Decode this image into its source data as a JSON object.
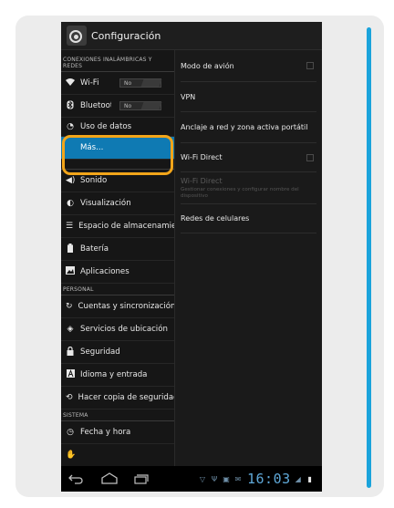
{
  "header": {
    "title": "Configuración"
  },
  "sections": {
    "wireless": "CONEXIONES INALÁMBRICAS Y REDES",
    "personal": "PERSONAL",
    "system": "SISTEMA"
  },
  "wireless_items": [
    {
      "label": "Wi-Fi",
      "toggle": "No"
    },
    {
      "label": "Bluetooth",
      "toggle": "No"
    },
    {
      "label": "Uso de datos"
    },
    {
      "label": "Más..."
    }
  ],
  "device_items": [
    {
      "label": "Sonido"
    },
    {
      "label": "Visualización"
    },
    {
      "label": "Espacio de almacenamiento"
    },
    {
      "label": "Batería"
    },
    {
      "label": "Aplicaciones"
    }
  ],
  "personal_items": [
    {
      "label": "Cuentas y sincronización"
    },
    {
      "label": "Servicios de ubicación"
    },
    {
      "label": "Seguridad"
    },
    {
      "label": "Idioma y entrada"
    },
    {
      "label": "Hacer copia de seguridad"
    }
  ],
  "system_items": [
    {
      "label": "Fecha y hora"
    }
  ],
  "right_items": [
    {
      "label": "Modo de avión",
      "checked": false
    },
    {
      "label": "VPN"
    },
    {
      "label": "Anclaje a red y zona activa portátil"
    },
    {
      "label": "Wi-Fi Direct",
      "checked": false
    },
    {
      "label": "Wi-Fi Direct",
      "sub": "Gestionar conexiones y configurar nombre del dispositivo",
      "disabled": true
    },
    {
      "label": "Redes de celulares"
    }
  ],
  "statusbar": {
    "time": "16:03"
  },
  "colors": {
    "selected": "#0f7ab3",
    "highlight": "#f2a51a",
    "clock": "#5fa8d8"
  }
}
